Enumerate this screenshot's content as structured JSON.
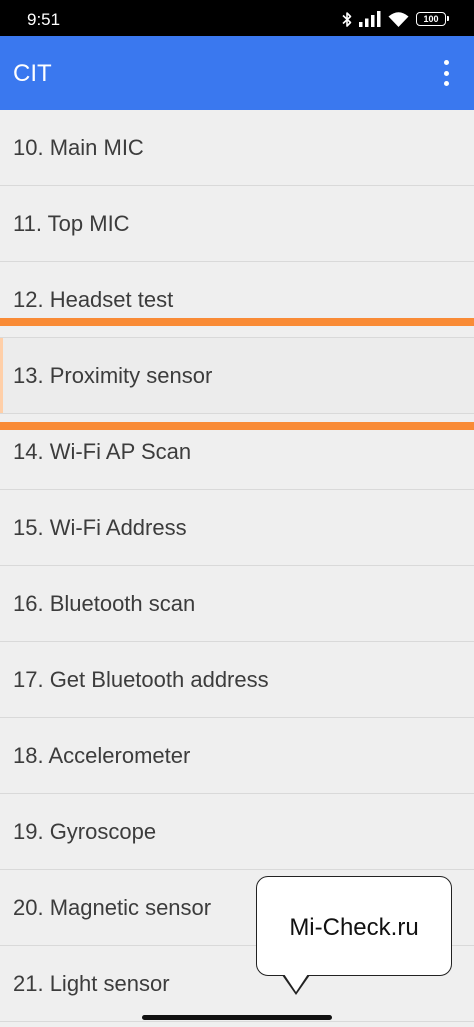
{
  "status_bar": {
    "time": "9:51",
    "battery": "100",
    "icons": [
      "bluetooth-icon",
      "signal-icon",
      "wifi-icon",
      "battery-icon"
    ]
  },
  "app_bar": {
    "title": "CIT",
    "menu_icon": "more-vertical-icon"
  },
  "list": {
    "items": [
      {
        "label": "10. Main MIC"
      },
      {
        "label": "11. Top MIC"
      },
      {
        "label": "12. Headset test"
      },
      {
        "label": "13. Proximity sensor",
        "highlighted": true
      },
      {
        "label": "14. Wi-Fi AP Scan"
      },
      {
        "label": "15. Wi-Fi Address"
      },
      {
        "label": "16. Bluetooth scan"
      },
      {
        "label": "17. Get Bluetooth address"
      },
      {
        "label": "18. Accelerometer"
      },
      {
        "label": "19. Gyroscope"
      },
      {
        "label": "20. Magnetic sensor"
      },
      {
        "label": "21. Light sensor"
      }
    ]
  },
  "watermark": {
    "text": "Mi-Check.ru"
  },
  "colors": {
    "app_bar": "#3a78ef",
    "highlight": "#f98b36",
    "list_background": "#efefef",
    "text": "#3c3c3c"
  }
}
